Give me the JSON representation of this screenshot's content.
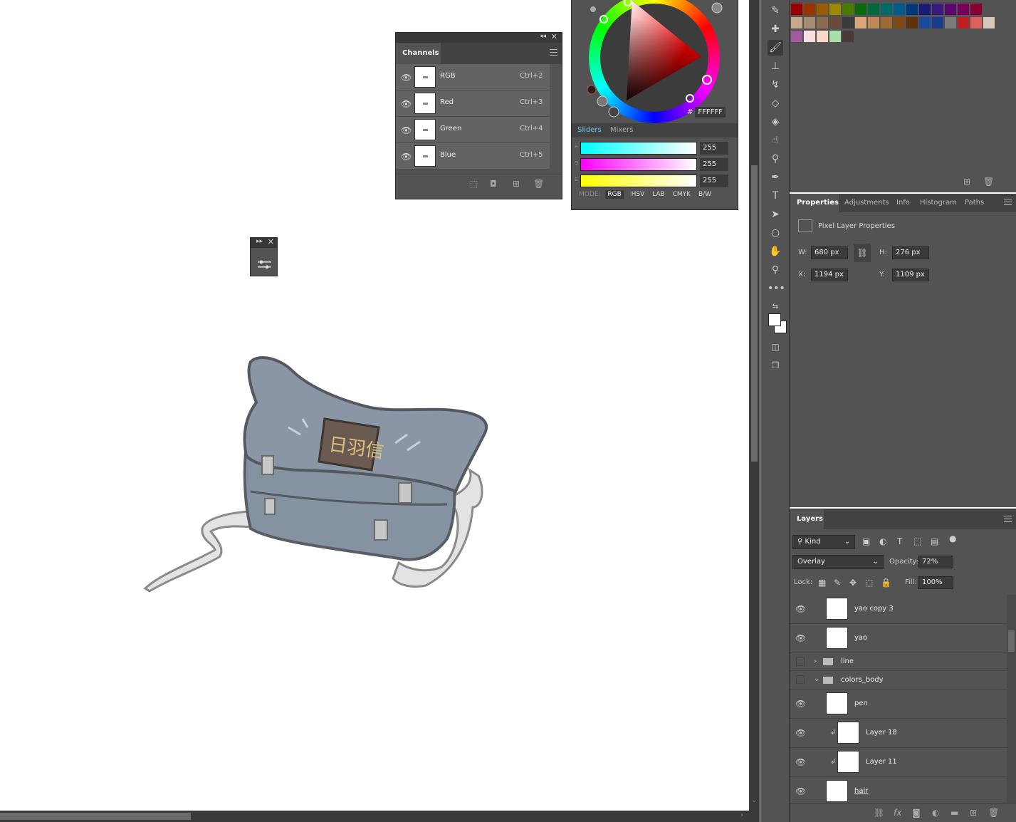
{
  "channels": {
    "tab": "Channels",
    "rows": [
      {
        "name": "RGB",
        "shortcut": "Ctrl+2"
      },
      {
        "name": "Red",
        "shortcut": "Ctrl+3"
      },
      {
        "name": "Green",
        "shortcut": "Ctrl+4"
      },
      {
        "name": "Blue",
        "shortcut": "Ctrl+5"
      }
    ]
  },
  "color": {
    "hex_prefix": "#",
    "hex": "FFFFFF",
    "tabs": {
      "sliders": "Sliders",
      "mixers": "Mixers"
    },
    "sliders": [
      {
        "label": "R",
        "value": "255",
        "color": "#00ffff"
      },
      {
        "label": "G",
        "value": "255",
        "color": "#ff00ff"
      },
      {
        "label": "B",
        "value": "255",
        "color": "#ffff00"
      }
    ],
    "mode_label": "MODE:",
    "modes": [
      "RGB",
      "HSV",
      "LAB",
      "CMYK",
      "B/W"
    ],
    "active_mode": "RGB"
  },
  "properties": {
    "tabs": [
      "Properties",
      "Adjustments",
      "Info",
      "Histogram",
      "Paths"
    ],
    "title": "Pixel Layer Properties",
    "w_label": "W:",
    "w_value": "680 px",
    "h_label": "H:",
    "h_value": "276 px",
    "x_label": "X:",
    "x_value": "1194 px",
    "y_label": "Y:",
    "y_value": "1109 px"
  },
  "layers": {
    "tab": "Layers",
    "kind": "Kind",
    "blend_mode": "Overlay",
    "opacity_label": "Opacity:",
    "opacity": "72%",
    "lock_label": "Lock:",
    "fill_label": "Fill:",
    "fill": "100%",
    "items": [
      {
        "name": "yao copy 3",
        "type": "layer",
        "visible": true
      },
      {
        "name": "yao",
        "type": "layer",
        "visible": true
      },
      {
        "name": "line",
        "type": "group-collapsed",
        "visible": false
      },
      {
        "name": "colors_body",
        "type": "group-open",
        "visible": false
      },
      {
        "name": "pen",
        "type": "layer",
        "visible": true
      },
      {
        "name": "Layer 18",
        "type": "clipped",
        "visible": true
      },
      {
        "name": "Layer 11",
        "type": "clipped",
        "visible": true
      },
      {
        "name": "hair",
        "type": "layer",
        "visible": true
      }
    ]
  },
  "stamp_text": "日羽信",
  "accent_colors": {
    "panel": "#535353",
    "dark": "#3a3a3a",
    "highlight": "#636363"
  }
}
